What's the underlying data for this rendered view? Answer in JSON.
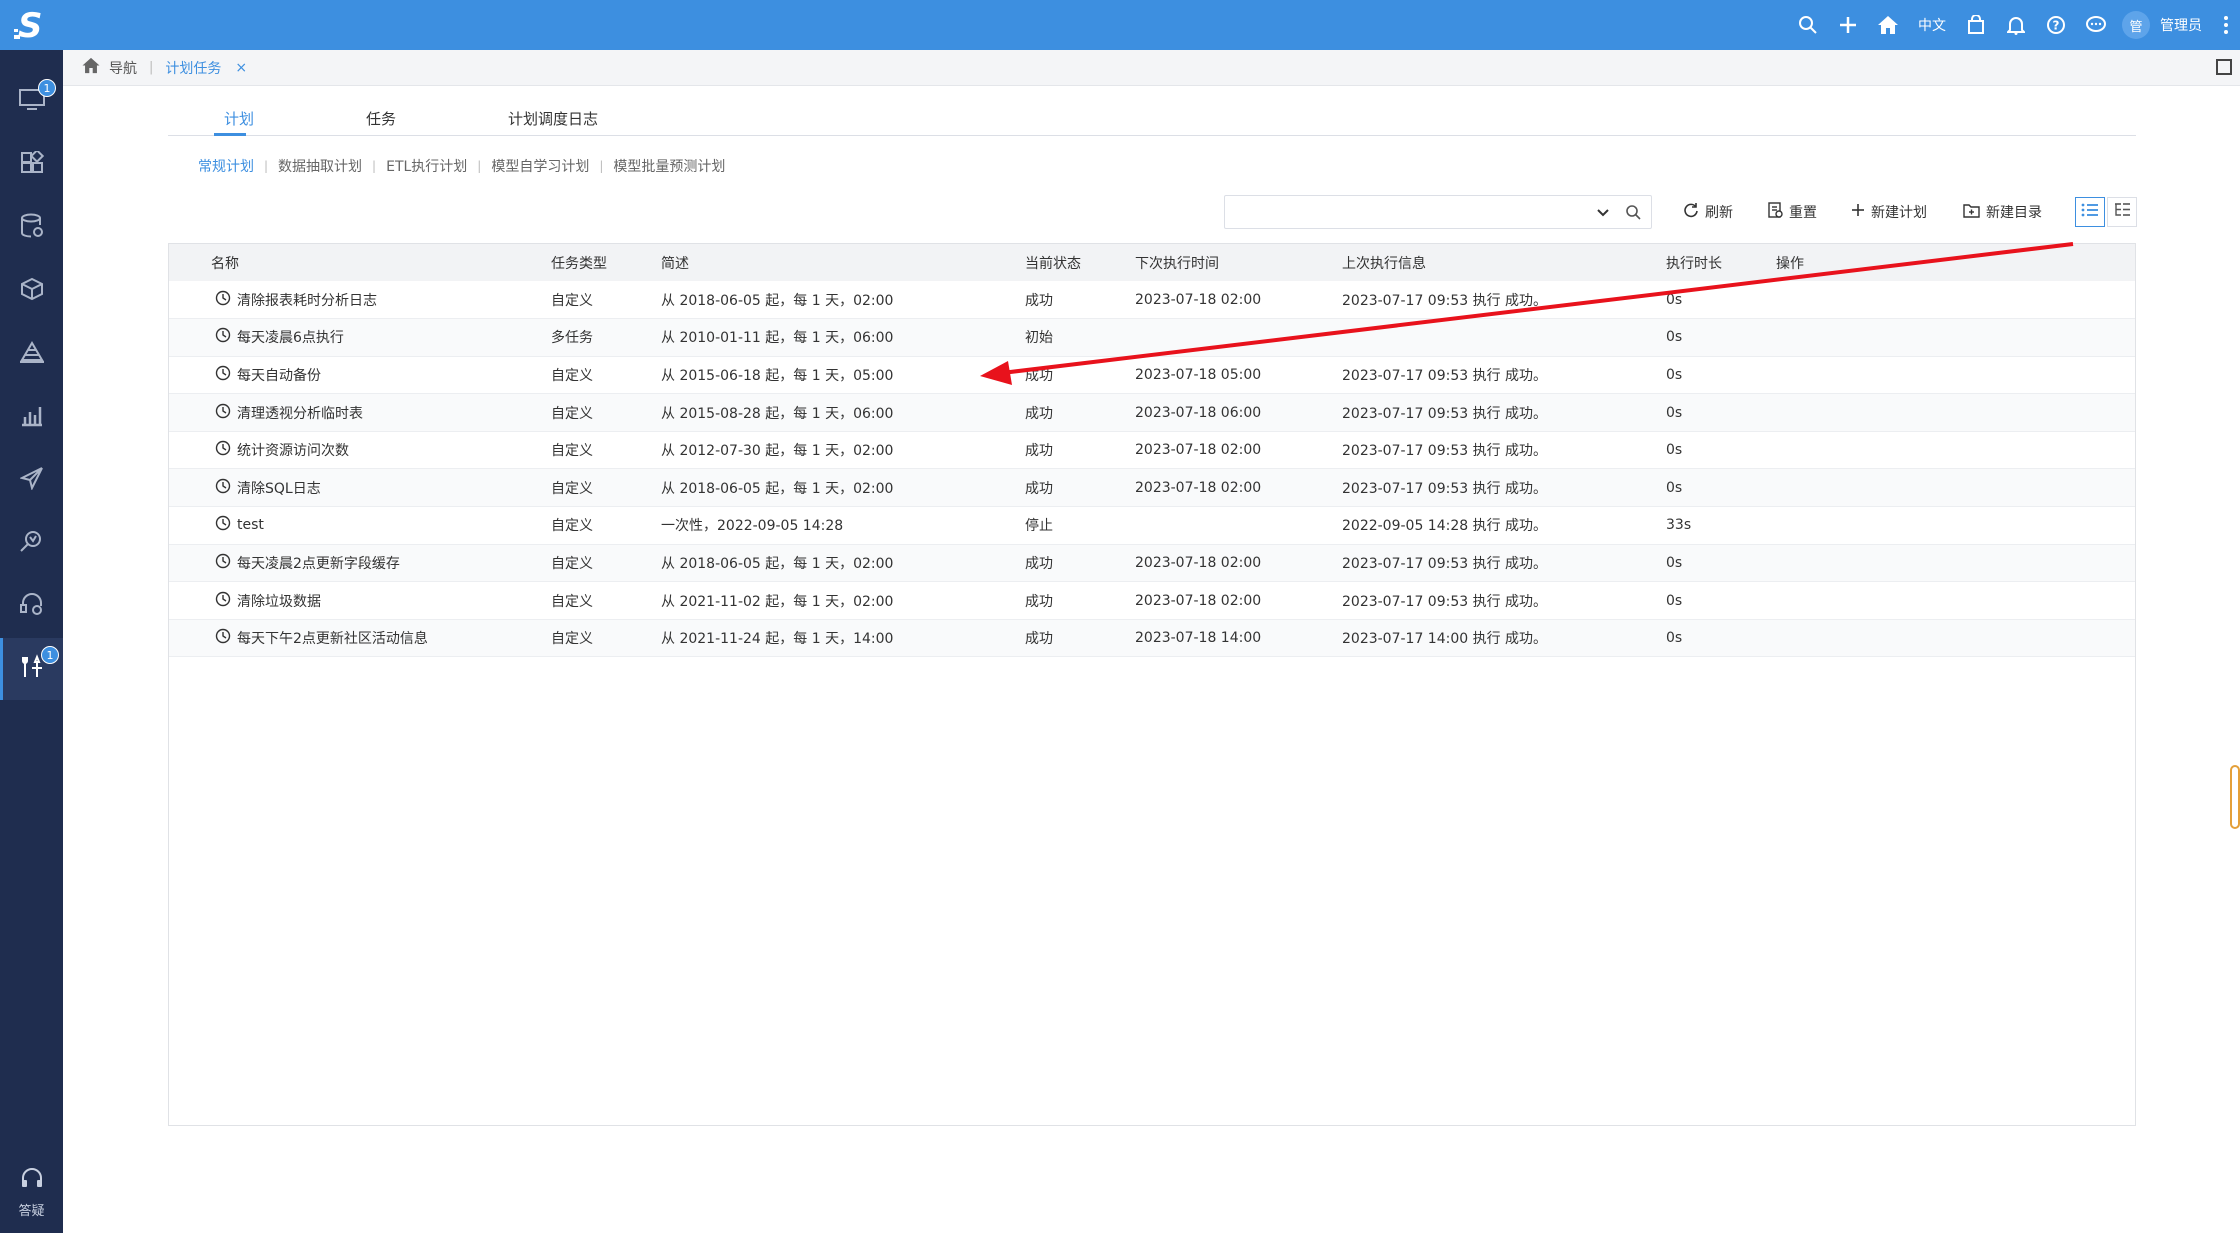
{
  "topbar": {
    "language": "中文",
    "avatar_text": "管",
    "username": "管理员",
    "icons": [
      "search-icon",
      "plus-icon",
      "home-icon",
      "bag-icon",
      "bell-icon",
      "help-icon",
      "chat-icon",
      "more-icon"
    ]
  },
  "sidebar": {
    "items": [
      {
        "icon": "monitor-icon",
        "badge": "1"
      },
      {
        "icon": "apps-icon",
        "badge": ""
      },
      {
        "icon": "database-icon",
        "badge": ""
      },
      {
        "icon": "cube-icon",
        "badge": ""
      },
      {
        "icon": "layers-icon",
        "badge": ""
      },
      {
        "icon": "chart-icon",
        "badge": ""
      },
      {
        "icon": "send-icon",
        "badge": ""
      },
      {
        "icon": "analysis-icon",
        "badge": ""
      },
      {
        "icon": "robot-icon",
        "badge": ""
      },
      {
        "icon": "tools-icon",
        "badge": "1",
        "active": true
      }
    ],
    "help_label": "答疑"
  },
  "breadcrumb": {
    "home_label": "导航",
    "tab_label": "计划任务",
    "close_glyph": "×"
  },
  "main_tabs": [
    {
      "label": "计划",
      "active": true
    },
    {
      "label": "任务",
      "active": false
    },
    {
      "label": "计划调度日志",
      "active": false
    }
  ],
  "sub_tabs": [
    {
      "label": "常规计划",
      "active": true
    },
    {
      "label": "数据抽取计划",
      "active": false
    },
    {
      "label": "ETL执行计划",
      "active": false
    },
    {
      "label": "模型自学习计划",
      "active": false
    },
    {
      "label": "模型批量预测计划",
      "active": false
    }
  ],
  "toolbar": {
    "search_value": "",
    "refresh_label": "刷新",
    "reset_label": "重置",
    "new_plan_label": "新建计划",
    "new_folder_label": "新建目录"
  },
  "table": {
    "columns": [
      "名称",
      "任务类型",
      "简述",
      "当前状态",
      "下次执行时间",
      "上次执行信息",
      "执行时长",
      "操作"
    ],
    "rows": [
      {
        "name": "清除报表耗时分析日志",
        "type": "自定义",
        "desc": "从 2018-06-05 起，每 1 天，02:00",
        "status": "成功",
        "next": "2023-07-18 02:00",
        "last": "2023-07-17 09:53 执行 成功。",
        "duration": "0s"
      },
      {
        "name": "每天凌晨6点执行",
        "type": "多任务",
        "desc": "从 2010-01-11 起，每 1 天，06:00",
        "status": "初始",
        "next": "",
        "last": "",
        "duration": "0s"
      },
      {
        "name": "每天自动备份",
        "type": "自定义",
        "desc": "从 2015-06-18 起，每 1 天，05:00",
        "status": "成功",
        "next": "2023-07-18 05:00",
        "last": "2023-07-17 09:53 执行 成功。",
        "duration": "0s"
      },
      {
        "name": "清理透视分析临时表",
        "type": "自定义",
        "desc": "从 2015-08-28 起，每 1 天，06:00",
        "status": "成功",
        "next": "2023-07-18 06:00",
        "last": "2023-07-17 09:53 执行 成功。",
        "duration": "0s"
      },
      {
        "name": "统计资源访问次数",
        "type": "自定义",
        "desc": "从 2012-07-30 起，每 1 天，02:00",
        "status": "成功",
        "next": "2023-07-18 02:00",
        "last": "2023-07-17 09:53 执行 成功。",
        "duration": "0s"
      },
      {
        "name": "清除SQL日志",
        "type": "自定义",
        "desc": "从 2018-06-05 起，每 1 天，02:00",
        "status": "成功",
        "next": "2023-07-18 02:00",
        "last": "2023-07-17 09:53 执行 成功。",
        "duration": "0s"
      },
      {
        "name": "test",
        "type": "自定义",
        "desc": "一次性，2022-09-05 14:28",
        "status": "停止",
        "next": "",
        "last": "2022-09-05 14:28 执行 成功。",
        "duration": "33s"
      },
      {
        "name": "每天凌晨2点更新字段缓存",
        "type": "自定义",
        "desc": "从 2018-06-05 起，每 1 天，02:00",
        "status": "成功",
        "next": "2023-07-18 02:00",
        "last": "2023-07-17 09:53 执行 成功。",
        "duration": "0s"
      },
      {
        "name": "清除垃圾数据",
        "type": "自定义",
        "desc": "从 2021-11-02 起，每 1 天，02:00",
        "status": "成功",
        "next": "2023-07-18 02:00",
        "last": "2023-07-17 09:53 执行 成功。",
        "duration": "0s"
      },
      {
        "name": "每天下午2点更新社区活动信息",
        "type": "自定义",
        "desc": "从 2021-11-24 起，每 1 天，14:00",
        "status": "成功",
        "next": "2023-07-18 14:00",
        "last": "2023-07-17 14:00 执行 成功。",
        "duration": "0s"
      }
    ]
  },
  "colors": {
    "topbar": "#3d8fe0",
    "sidebar": "#1f2d4f",
    "accent": "#3d8fe0",
    "annotation_arrow": "#e8121c"
  }
}
